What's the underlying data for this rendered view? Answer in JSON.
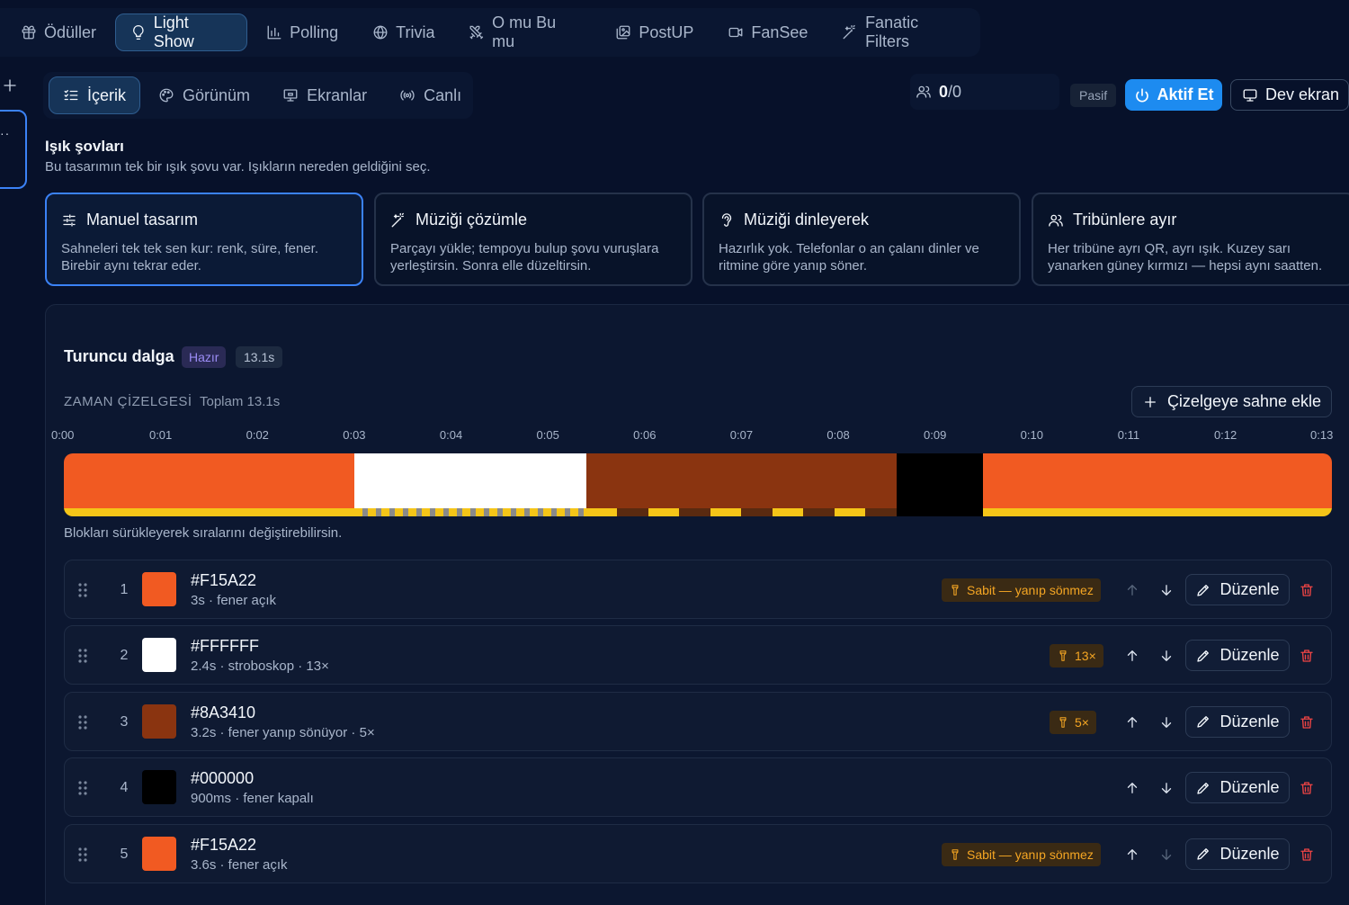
{
  "top_tabs": [
    {
      "label": "Ödüller",
      "icon": "gift-icon"
    },
    {
      "label": "Light Show",
      "icon": "lightbulb-icon",
      "active": true
    },
    {
      "label": "Polling",
      "icon": "bar-chart-icon"
    },
    {
      "label": "Trivia",
      "icon": "globe-icon"
    },
    {
      "label": "O mu Bu mu",
      "icon": "swords-icon"
    },
    {
      "label": "PostUP",
      "icon": "images-icon"
    },
    {
      "label": "FanSee",
      "icon": "video-icon"
    },
    {
      "label": "Fanatic Filters",
      "icon": "wand-icon"
    }
  ],
  "sub_tabs": [
    {
      "label": "İçerik",
      "icon": "list-check-icon",
      "active": true
    },
    {
      "label": "Görünüm",
      "icon": "palette-icon"
    },
    {
      "label": "Ekranlar",
      "icon": "presentation-icon"
    },
    {
      "label": "Canlı",
      "icon": "broadcast-icon"
    }
  ],
  "header": {
    "count_current": "0",
    "count_total": "/0",
    "status": "Pasif",
    "activate_label": "Aktif Et",
    "big_screen_label": "Dev ekran"
  },
  "section": {
    "title": "Işık şovları",
    "subtitle": "Bu tasarımın tek bir ışık şovu var. Işıkların nereden geldiğini seç."
  },
  "modes": [
    {
      "title": "Manuel tasarım",
      "icon": "sliders-icon",
      "desc": "Sahneleri tek tek sen kur: renk, süre, fener. Birebir aynı tekrar eder.",
      "active": true
    },
    {
      "title": "Müziği çözümle",
      "icon": "wand-icon",
      "desc": "Parçayı yükle; tempoyu bulup şovu vuruşlara yerleştirsin. Sonra elle düzeltirsin."
    },
    {
      "title": "Müziği dinleyerek",
      "icon": "ear-icon",
      "desc": "Hazırlık yok. Telefonlar o an çalanı dinler ve ritmine göre yanıp söner."
    },
    {
      "title": "Tribünlere ayır",
      "icon": "users-icon",
      "desc": "Her tribüne ayrı QR, ayrı ışık. Kuzey sarı yanarken güney kırmızı — hepsi aynı saatten."
    }
  ],
  "show": {
    "title": "Turuncu dalga",
    "status_badge": "Hazır",
    "duration_badge": "13.1s",
    "timeline_label": "ZAMAN ÇİZELGESİ",
    "timeline_total": "Toplam 13.1s",
    "add_scene_label": "Çizelgeye sahne ekle",
    "hint": "Blokları sürükleyerek sıralarını değiştirebilirsin.",
    "ticks": [
      "0:00",
      "0:01",
      "0:02",
      "0:03",
      "0:04",
      "0:05",
      "0:06",
      "0:07",
      "0:08",
      "0:09",
      "0:10",
      "0:11",
      "0:12",
      "0:13"
    ],
    "timeline_max_seconds": 13.1
  },
  "scenes": [
    {
      "index": "1",
      "color": "#F15A22",
      "hex": "#F15A22",
      "duration_s": 3,
      "meta": "3s · fener açık",
      "tag": "Sabit — yanıp sönmez",
      "strip": "solid",
      "up_disabled": true,
      "down_disabled": false
    },
    {
      "index": "2",
      "color": "#FFFFFF",
      "hex": "#FFFFFF",
      "duration_s": 2.4,
      "meta": "2.4s · stroboskop · 13×",
      "tag": "13×",
      "strip": "strobe",
      "up_disabled": false,
      "down_disabled": false
    },
    {
      "index": "3",
      "color": "#8A3410",
      "hex": "#8A3410",
      "duration_s": 3.2,
      "meta": "3.2s · fener yanıp sönüyor · 5×",
      "tag": "5×",
      "strip": "blink",
      "up_disabled": false,
      "down_disabled": false
    },
    {
      "index": "4",
      "color": "#000000",
      "hex": "#000000",
      "duration_s": 0.9,
      "meta": "900ms · fener kapalı",
      "tag": "",
      "strip": "off",
      "up_disabled": false,
      "down_disabled": false
    },
    {
      "index": "5",
      "color": "#F15A22",
      "hex": "#F15A22",
      "duration_s": 3.6,
      "meta": "3.6s · fener açık",
      "tag": "Sabit — yanıp sönmez",
      "strip": "solid",
      "up_disabled": false,
      "down_disabled": true
    }
  ],
  "edit_label": "Düzenle",
  "colors": {
    "accent": "#1D8BF0",
    "flash": "#F5C518",
    "danger": "#EF4444"
  }
}
